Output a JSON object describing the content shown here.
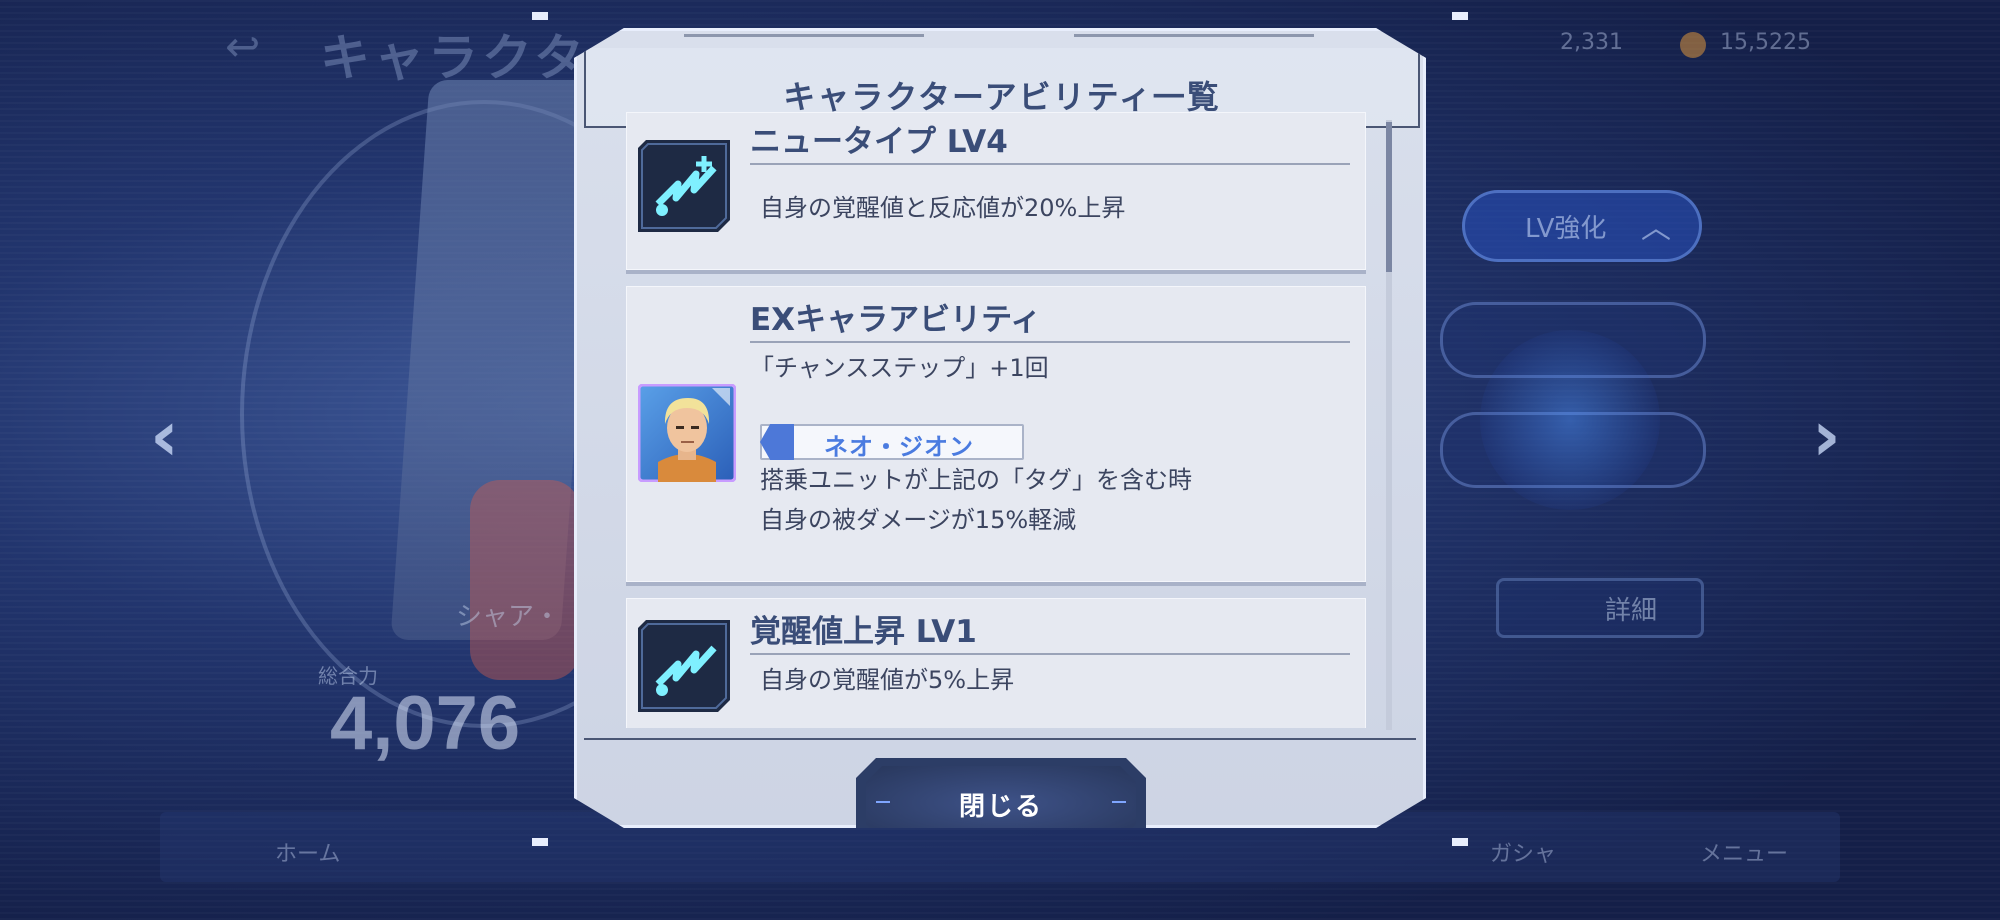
{
  "background": {
    "title": "キャラクタ",
    "power_label": "総合力",
    "power_value": "4,076",
    "character_name": "シャア・",
    "lv_up_label": "LV強化",
    "detail_label": "詳細",
    "currency_a": "2,331",
    "currency_b": "15,5225",
    "nav": {
      "home": "ホーム",
      "gacha": "ガシャ",
      "menu": "メニュー"
    }
  },
  "dialog": {
    "title": "キャラクターアビリティ一覧",
    "close_label": "閉じる",
    "abilities": [
      {
        "title": "ニュータイプ LV4",
        "description": "自身の覚醒値と反応値が20%上昇",
        "icon": "newtype-ability-icon"
      },
      {
        "title": "EXキャラアビリティ",
        "line1": "「チャンスステップ」+1回",
        "tag": "ネオ・ジオン",
        "line2": "搭乗ユニットが上記の「タグ」を含む時",
        "line3": "自身の被ダメージが15%軽減",
        "icon": "character-portrait"
      },
      {
        "title": "覚醒値上昇 LV1",
        "description": "自身の覚醒値が5%上昇",
        "icon": "awakening-ability-icon"
      }
    ]
  },
  "colors": {
    "accent": "#3a4d78",
    "tag_blue": "#4a7be0",
    "icon_cyan": "#7ff0ff",
    "button_bg": "#2c3d66"
  }
}
